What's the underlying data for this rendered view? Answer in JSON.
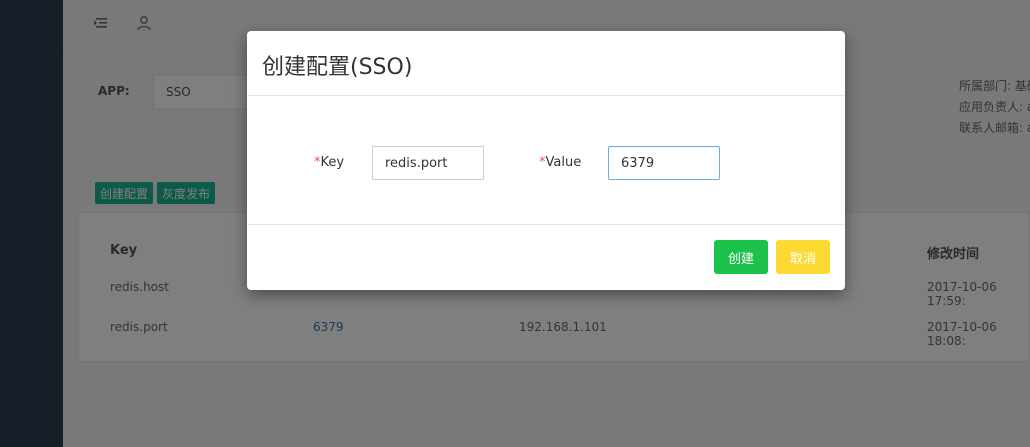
{
  "app": {
    "label": "APP:",
    "selected": "SSO"
  },
  "info": {
    "department": "所属部门: 基础",
    "owner": "应用负责人: a",
    "email": "联系人邮箱: a"
  },
  "actions": {
    "create_config": "创建配置",
    "gray_release": "灰度发布"
  },
  "table": {
    "headers": {
      "key": "Key",
      "modified": "修改时间"
    },
    "rows": [
      {
        "key": "redis.host",
        "value": "",
        "host": "",
        "modified": "2017-10-06 17:59:"
      },
      {
        "key": "redis.port",
        "value": "6379",
        "host": "192.168.1.101",
        "modified": "2017-10-06 18:08:"
      }
    ]
  },
  "modal": {
    "title": "创建配置(SSO)",
    "required_mark": "*",
    "key_label": "Key",
    "key_value": "redis.port",
    "value_label": "Value",
    "value_value": "6379",
    "ok_label": "创建",
    "cancel_label": "取消"
  },
  "colors": {
    "sidebar": "#2f4050",
    "primary": "#1ab394",
    "ok_button": "#1cc24b",
    "cancel_button": "#fcd933",
    "required": "#ed5565"
  }
}
